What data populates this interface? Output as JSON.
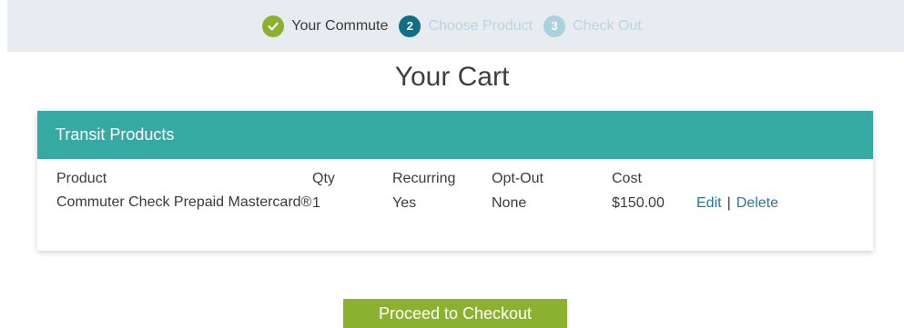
{
  "stepper": {
    "steps": [
      {
        "number": "",
        "label": "Your Commute",
        "state": "completed",
        "icon": "check-icon"
      },
      {
        "number": "2",
        "label": "Choose Product",
        "state": "current"
      },
      {
        "number": "3",
        "label": "Check Out",
        "state": "upcoming"
      }
    ]
  },
  "page": {
    "title": "Your Cart"
  },
  "cart": {
    "section_title": "Transit Products",
    "columns": {
      "product": "Product",
      "qty": "Qty",
      "recurring": "Recurring",
      "opt_out": "Opt-Out",
      "cost": "Cost"
    },
    "items": [
      {
        "product": "Commuter Check Prepaid Mastercard®",
        "qty": "1",
        "recurring": "Yes",
        "opt_out": "None",
        "cost": "$150.00",
        "edit_label": "Edit",
        "separator": "|",
        "delete_label": "Delete"
      }
    ]
  },
  "actions": {
    "checkout_label": "Proceed to Checkout"
  },
  "colors": {
    "accent_green": "#8cb131",
    "teal_header": "#36a9a3",
    "current_step": "#0f6f86",
    "link": "#1e7aa6"
  }
}
